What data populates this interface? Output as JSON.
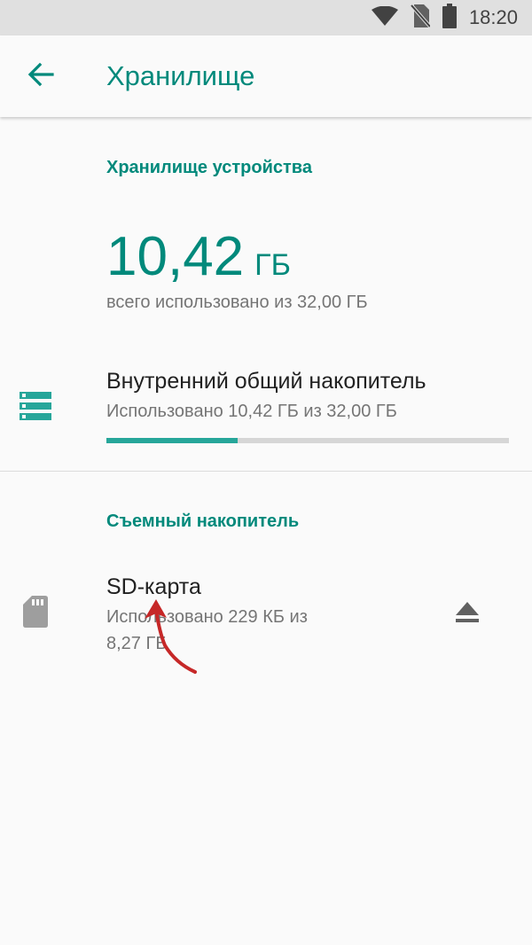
{
  "status_bar": {
    "time": "18:20",
    "icons": [
      "wifi-icon",
      "no-sim-icon",
      "battery-icon"
    ]
  },
  "app_bar": {
    "back_icon": "arrow-back-icon",
    "title": "Хранилище"
  },
  "device_storage": {
    "header": "Хранилище устройства",
    "used_value": "10,42",
    "used_unit": "ГБ",
    "summary": "всего использовано из 32,00 ГБ"
  },
  "internal_storage": {
    "icon": "storage-icon",
    "title": "Внутренний общий накопитель",
    "subtitle": "Использовано 10,42 ГБ из 32,00 ГБ",
    "used_fraction": 0.3256
  },
  "removable": {
    "header": "Съемный накопитель",
    "sd_card": {
      "icon": "sd-card-icon",
      "title": "SD-карта",
      "subtitle_line1": "Использовано 229 КБ из",
      "subtitle_line2": "8,27 ГБ",
      "action_icon": "eject-icon"
    }
  },
  "colors": {
    "accent": "#00897b",
    "progress": "#26a69a",
    "annotation_arrow": "#c62828"
  }
}
